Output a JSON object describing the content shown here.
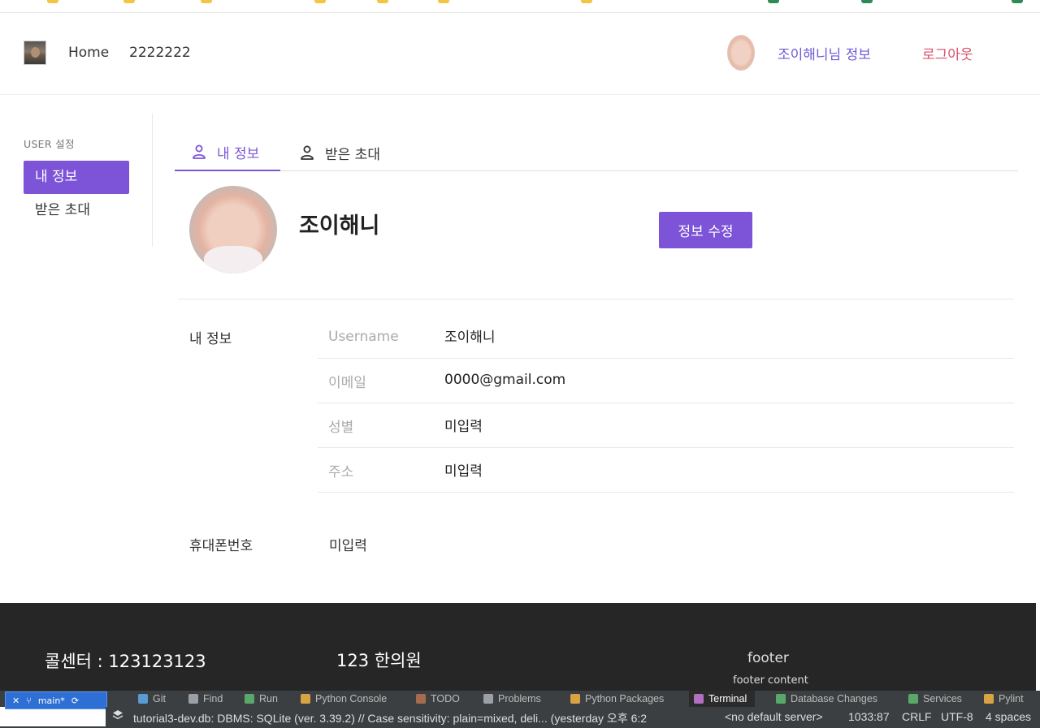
{
  "header": {
    "nav_home": "Home",
    "nav_second": "2222222",
    "user_info_link": "조이해니님 정보",
    "logout_link": "로그아웃"
  },
  "sidebar": {
    "title": "USER 설정",
    "items": [
      {
        "label": "내 정보",
        "active": true
      },
      {
        "label": "받은 초대",
        "active": false
      }
    ]
  },
  "tabs": [
    {
      "label": "내 정보",
      "icon": "user-icon",
      "active": true
    },
    {
      "label": "받은 초대",
      "icon": "user-icon",
      "active": false
    }
  ],
  "profile": {
    "name": "조이해니",
    "edit_button": "정보 수정"
  },
  "info": {
    "section_label": "내 정보",
    "rows": [
      {
        "key": "Username",
        "value": "조이해니"
      },
      {
        "key": "이메일",
        "value": "0000@gmail.com"
      },
      {
        "key": "성별",
        "value": "미입력"
      },
      {
        "key": "주소",
        "value": "미입력"
      }
    ],
    "phone_label": "휴대폰번호",
    "phone_value": "미입력"
  },
  "footer": {
    "call_center": "콜센터 : 123123123",
    "address": "123 한의원",
    "title": "footer",
    "content": "footer content"
  },
  "ide": {
    "branch": "main*",
    "tools": [
      {
        "label": "Git",
        "icon": "git-icon",
        "color": "#5a9bd5"
      },
      {
        "label": "Find",
        "icon": "find-icon",
        "color": "#9aa0a6"
      },
      {
        "label": "Run",
        "icon": "run-icon",
        "color": "#59a869"
      },
      {
        "label": "Python Console",
        "icon": "python-console-icon",
        "color": "#d9a343"
      },
      {
        "label": "TODO",
        "icon": "todo-icon",
        "color": "#a56b50"
      },
      {
        "label": "Problems",
        "icon": "problems-icon",
        "color": "#9aa0a6"
      },
      {
        "label": "Python Packages",
        "icon": "packages-icon",
        "color": "#d9a343"
      },
      {
        "label": "Terminal",
        "icon": "terminal-icon",
        "color": "#b06fbf",
        "active": true
      },
      {
        "label": "Database Changes",
        "icon": "database-icon",
        "color": "#59a869"
      },
      {
        "label": "Services",
        "icon": "services-icon",
        "color": "#59a869"
      },
      {
        "label": "Pylint",
        "icon": "pylint-icon",
        "color": "#d9a343"
      }
    ],
    "status_message": "tutorial3-dev.db: DBMS: SQLite (ver. 3.39.2) // Case sensitivity: plain=mixed, deli... (yesterday 오후 6:2",
    "server": "<no default server>",
    "position": "1033:87",
    "line_sep": "CRLF",
    "encoding": "UTF-8",
    "indent": "4 spaces"
  },
  "colors": {
    "accent": "#7d54d8",
    "logout": "#d94f6b",
    "footer_bg": "#262626"
  }
}
